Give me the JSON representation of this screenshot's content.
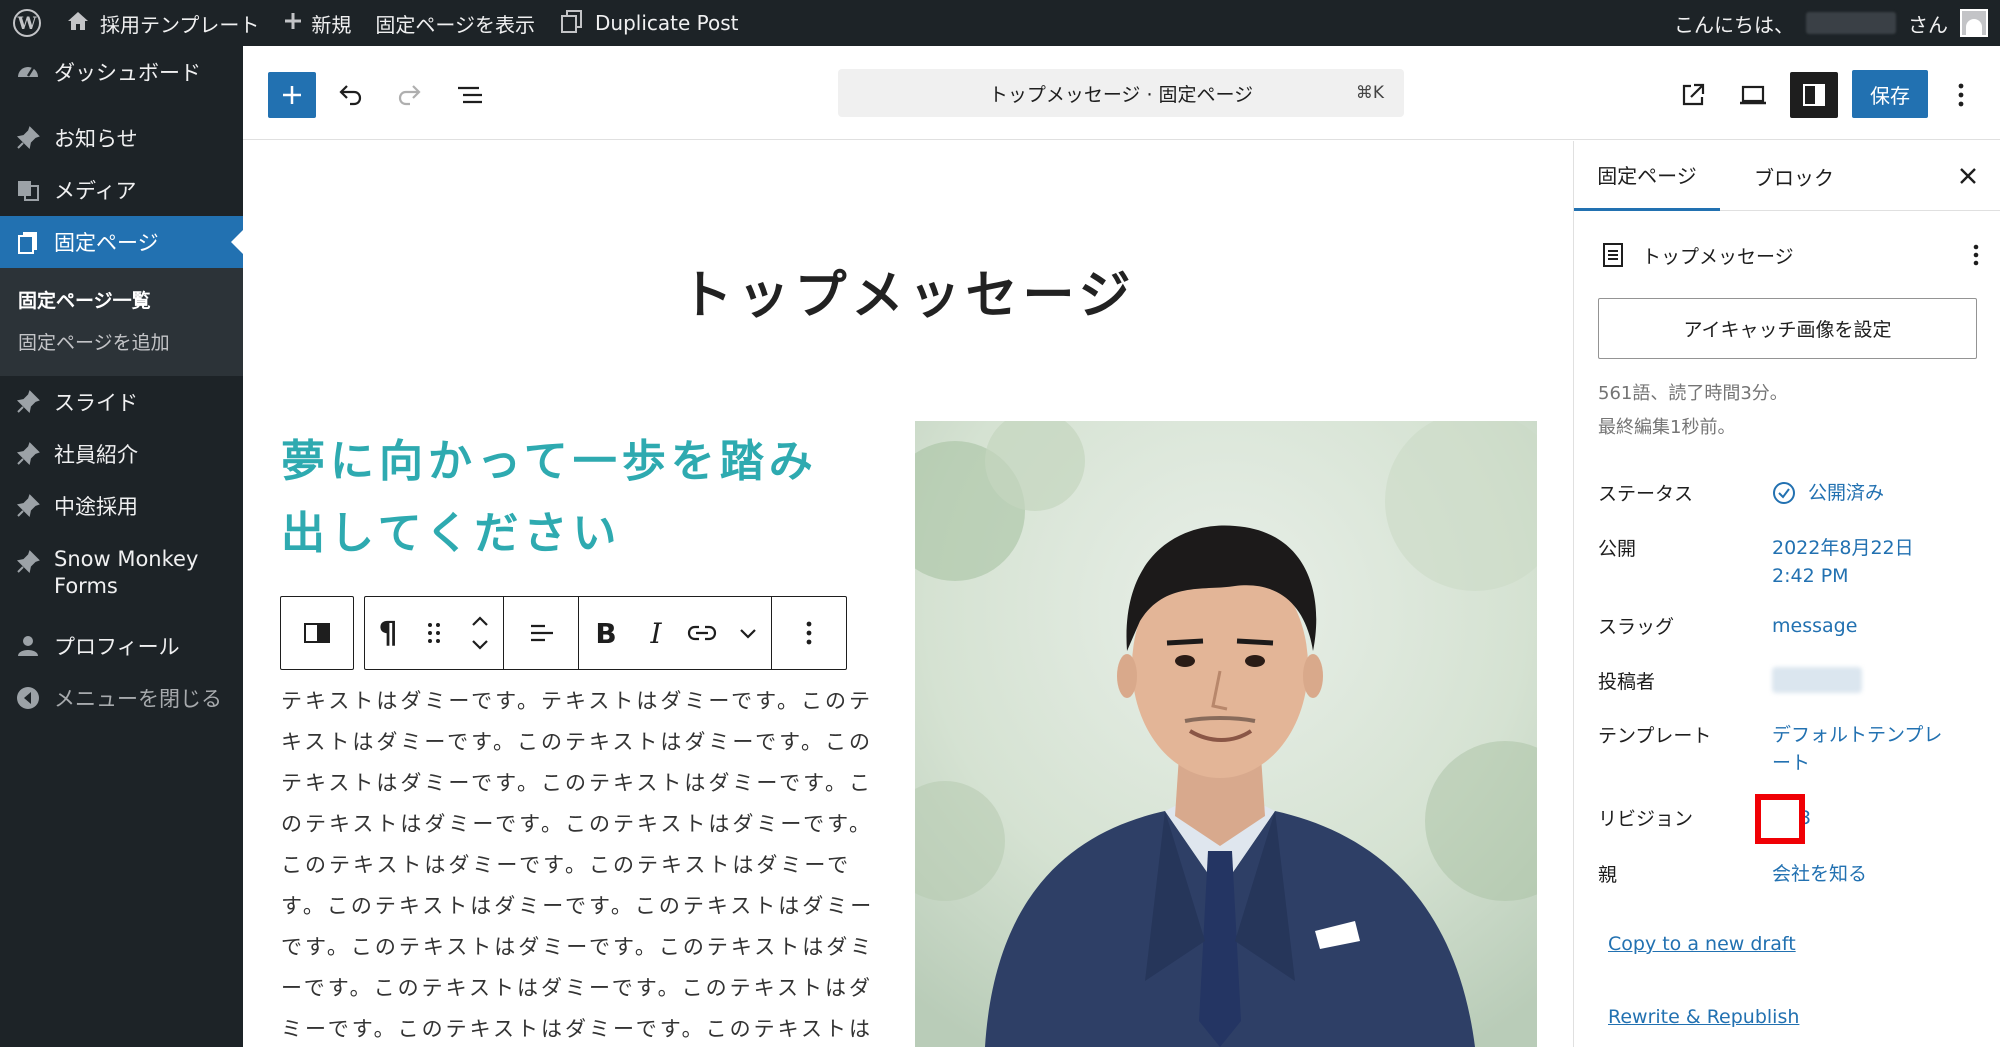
{
  "admin_bar": {
    "site_name": "採用テンプレート",
    "new_label": "新規",
    "view_page": "固定ページを表示",
    "duplicate_post": "Duplicate Post",
    "greeting_prefix": "こんにちは、",
    "greeting_suffix": "さん"
  },
  "sidebar": {
    "items": [
      {
        "label": "ダッシュボード",
        "icon": "dashboard-icon"
      },
      {
        "label": "お知らせ",
        "icon": "pin-icon"
      },
      {
        "label": "メディア",
        "icon": "media-icon"
      },
      {
        "label": "固定ページ",
        "icon": "pages-icon",
        "current": true
      },
      {
        "label": "スライド",
        "icon": "pin-icon"
      },
      {
        "label": "社員紹介",
        "icon": "pin-icon"
      },
      {
        "label": "中途採用",
        "icon": "pin-icon"
      },
      {
        "label": "Snow Monkey Forms",
        "icon": "pin-icon"
      },
      {
        "label": "プロフィール",
        "icon": "user-icon"
      },
      {
        "label": "メニューを閉じる",
        "icon": "collapse-icon"
      }
    ],
    "submenu": [
      "固定ページ一覧",
      "固定ページを追加"
    ]
  },
  "toolbar": {
    "command_title": "トップメッセージ · 固定ページ",
    "command_shortcut": "⌘K",
    "save_label": "保存"
  },
  "canvas": {
    "page_title": "トップメッセージ",
    "heading": "夢に向かって一歩を踏み出してください",
    "paragraph": "テキストはダミーです。テキストはダミーです。このテキストはダミーです。このテキストはダミーです。このテキストはダミーです。このテキストはダミーです。このテキストはダミーです。このテキストはダミーです。このテキストはダミーです。このテキストはダミーです。このテキストはダミーです。このテキストはダミーです。このテキストはダミーです。このテキストはダミーです。このテキストはダミーです。このテキストはダミーです。このテキストはダミーです。このテキストはダミーで"
  },
  "settings": {
    "tab_page": "固定ページ",
    "tab_block": "ブロック",
    "doc_title": "トップメッセージ",
    "featured_image_btn": "アイキャッチ画像を設定",
    "word_count": "561語、読了時間3分。",
    "last_edited": "最終編集1秒前。",
    "rows": {
      "status": {
        "label": "ステータス",
        "value": "公開済み"
      },
      "publish": {
        "label": "公開",
        "value_line1": "2022年8月22日",
        "value_line2": "2:42 PM"
      },
      "slug": {
        "label": "スラッグ",
        "value": "message"
      },
      "author": {
        "label": "投稿者"
      },
      "template": {
        "label": "テンプレート",
        "value_line1": "デフォルトテンプレ",
        "value_line2": "ート"
      },
      "revisions": {
        "label": "リビジョン",
        "value": "3"
      },
      "parent": {
        "label": "親",
        "value": "会社を知る"
      }
    },
    "copy_draft": "Copy to a new draft",
    "rewrite_republish": "Rewrite & Republish"
  },
  "colors": {
    "accent": "#2271b1",
    "heading_teal": "#2eaab0",
    "highlight": "#f00005"
  }
}
